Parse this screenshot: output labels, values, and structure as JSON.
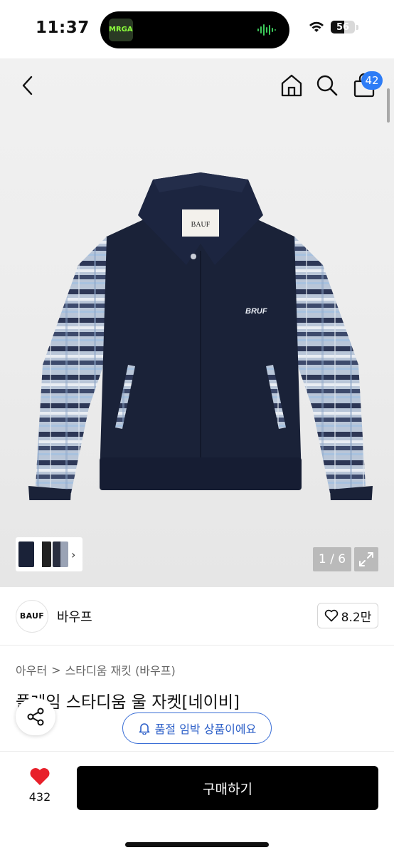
{
  "status_bar": {
    "time": "11:37",
    "battery": "56",
    "island_art_text": "MRGAE"
  },
  "header": {
    "cart_count": "42"
  },
  "gallery": {
    "counter": "1 / 6",
    "thumb_arrow": "›",
    "jacket_logo": "BRUF",
    "jacket_tag": "BAUF"
  },
  "brand": {
    "logo_text": "BAUF",
    "name": "바우프",
    "like_count": "8.2만"
  },
  "product": {
    "breadcrumb": [
      "아우터",
      "스타디움 재킷 (바우프)"
    ],
    "breadcrumb_sep": ">",
    "title": "플레임 스타디움 울 자켓[네이비]",
    "restock_label": "품절 임박 상품이에요"
  },
  "bottom": {
    "wish_count": "432",
    "buy_label": "구매하기"
  },
  "colors": {
    "accent_blue": "#2d7cf6",
    "restock_blue": "#2c5fc8",
    "heart_red": "#e8202a",
    "navy": "#1a2238"
  },
  "icons": [
    "back-icon",
    "home-icon",
    "search-icon",
    "shopping-bag-icon",
    "expand-icon",
    "heart-outline-icon",
    "share-icon",
    "bell-icon",
    "heart-filled-icon",
    "wifi-icon",
    "battery-icon"
  ]
}
